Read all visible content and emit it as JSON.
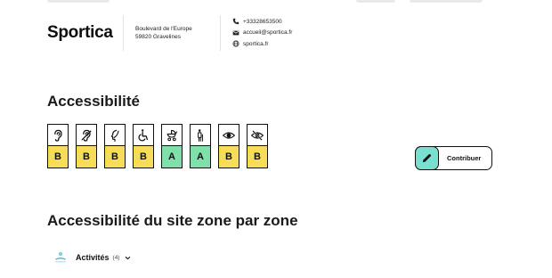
{
  "header": {
    "brand": "Sportica",
    "address_line1": "Boulevard de l'Europe",
    "address_line2": "59820 Gravelines",
    "phone": "+33328653500",
    "email": "accueil@sportica.fr",
    "website": "sportica.fr",
    "icons": {
      "phone": "phone-icon",
      "email": "envelope-icon",
      "website": "globe-icon"
    }
  },
  "accessibility": {
    "title": "Accessibilité",
    "badges": [
      {
        "icon": "ear-icon",
        "grade": "B"
      },
      {
        "icon": "ear-strike-icon",
        "grade": "B"
      },
      {
        "icon": "head-profile-icon",
        "grade": "B"
      },
      {
        "icon": "wheelchair-icon",
        "grade": "B"
      },
      {
        "icon": "stroller-icon",
        "grade": "A"
      },
      {
        "icon": "elderly-person-icon",
        "grade": "A"
      },
      {
        "icon": "eye-icon",
        "grade": "B"
      },
      {
        "icon": "eye-strike-icon",
        "grade": "B"
      }
    ],
    "grade_colors": {
      "A": "#7fe0ac",
      "B": "#f7dc58"
    },
    "contribute_label": "Contribuer",
    "contribute_icon": "pencil-icon",
    "contribute_icon_bg": "#79dfcf"
  },
  "zones": {
    "title": "Accessibilité du site zone par zone",
    "items": [
      {
        "label": "Activités",
        "count": "(4)",
        "icon": "activity-logo-icon",
        "expand_icon": "chevron-down-icon"
      }
    ]
  }
}
